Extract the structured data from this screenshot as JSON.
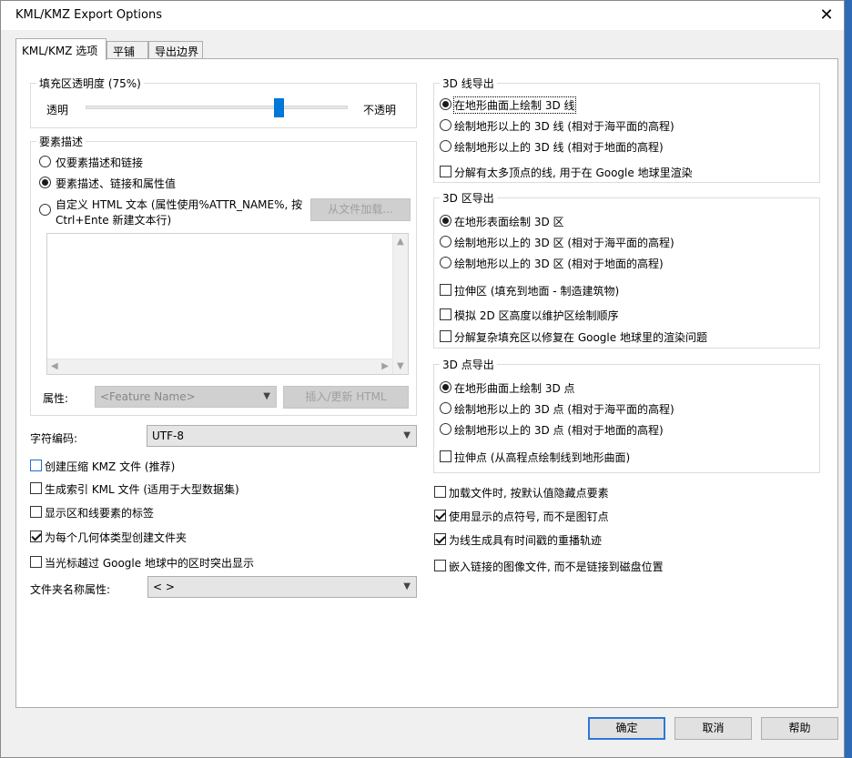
{
  "window": {
    "title": "KML/KMZ Export Options",
    "close_glyph": "✕"
  },
  "tabs": [
    {
      "label": "KML/KMZ 选项",
      "active": true
    },
    {
      "label": "平铺",
      "active": false
    },
    {
      "label": "导出边界",
      "active": false
    }
  ],
  "fill_opacity": {
    "legend": "填充区透明度 (75%)",
    "left_label": "透明",
    "right_label": "不透明",
    "value_percent": 75
  },
  "feature_desc": {
    "legend": "要素描述",
    "options": [
      {
        "label": "仅要素描述和链接",
        "selected": false
      },
      {
        "label": "要素描述、链接和属性值",
        "selected": true
      },
      {
        "label": "自定义 HTML 文本 (属性使用%ATTR_NAME%, 按",
        "label2": "Ctrl+Ente 新建文本行)",
        "selected": false
      }
    ],
    "load_file_button": "从文件加载...",
    "attr_label": "属性:",
    "attr_combo": "<Feature Name>",
    "insert_button": "插入/更新 HTML"
  },
  "encoding": {
    "label": "字符编码:",
    "value": "UTF-8"
  },
  "left_checks": [
    {
      "label": "创建压缩 KMZ 文件 (推荐)",
      "checked": false
    },
    {
      "label": "生成索引 KML 文件 (适用于大型数据集)",
      "checked": false
    },
    {
      "label": "显示区和线要素的标签",
      "checked": false
    },
    {
      "label": "为每个几何体类型创建文件夹",
      "checked": true
    },
    {
      "label": "当光标越过 Google 地球中的区时突出显示",
      "checked": false
    }
  ],
  "folder_name": {
    "label": "文件夹名称属性:",
    "value": "< >"
  },
  "line_export": {
    "legend": "3D 线导出",
    "options": [
      {
        "label": "在地形曲面上绘制 3D 线",
        "selected": true
      },
      {
        "label": "绘制地形以上的 3D 线 (相对于海平面的高程)",
        "selected": false
      },
      {
        "label": "绘制地形以上的 3D 线 (相对于地面的高程)",
        "selected": false
      }
    ],
    "checks": [
      {
        "label": "分解有太多顶点的线, 用于在 Google 地球里渲染",
        "checked": false
      }
    ]
  },
  "area_export": {
    "legend": "3D 区导出",
    "options": [
      {
        "label": "在地形表面绘制 3D 区",
        "selected": true
      },
      {
        "label": "绘制地形以上的 3D 区 (相对于海平面的高程)",
        "selected": false
      },
      {
        "label": "绘制地形以上的 3D 区 (相对于地面的高程)",
        "selected": false
      }
    ],
    "checks": [
      {
        "label": "拉伸区 (填充到地面 - 制造建筑物)",
        "checked": false
      },
      {
        "label": "模拟 2D 区高度以维护区绘制顺序",
        "checked": false
      },
      {
        "label": "分解复杂填充区以修复在 Google 地球里的渲染问题",
        "checked": false
      }
    ]
  },
  "point_export": {
    "legend": "3D 点导出",
    "options": [
      {
        "label": "在地形曲面上绘制 3D 点",
        "selected": true
      },
      {
        "label": "绘制地形以上的 3D 点 (相对于海平面的高程)",
        "selected": false
      },
      {
        "label": "绘制地形以上的 3D 点 (相对于地面的高程)",
        "selected": false
      }
    ],
    "checks": [
      {
        "label": "拉伸点 (从高程点绘制线到地形曲面)",
        "checked": false
      }
    ]
  },
  "right_checks": [
    {
      "label": "加载文件时, 按默认值隐藏点要素",
      "checked": false
    },
    {
      "label": "使用显示的点符号, 而不是图钉点",
      "checked": true
    },
    {
      "label": "为线生成具有时间戳的重播轨迹",
      "checked": true
    },
    {
      "label": "嵌入链接的图像文件, 而不是链接到磁盘位置",
      "checked": false
    }
  ],
  "buttons": {
    "ok": "确定",
    "cancel": "取消",
    "help": "帮助"
  }
}
